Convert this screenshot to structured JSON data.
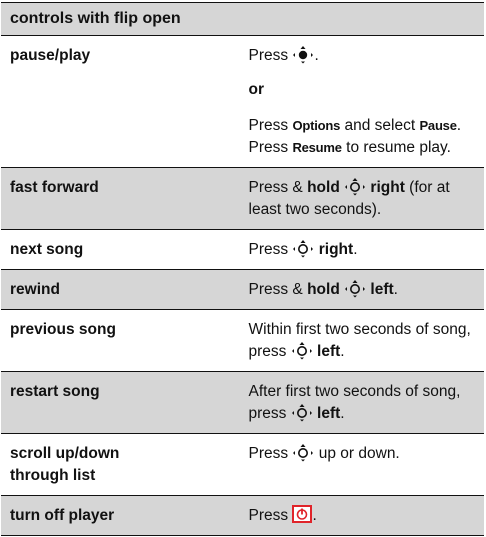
{
  "header": {
    "title": "controls with flip open"
  },
  "rows": [
    {
      "label": "pause/play",
      "lines": [
        {
          "parts": [
            {
              "t": "Press "
            },
            {
              "icon": "nav-center-key"
            },
            {
              "t": "."
            }
          ]
        }
      ],
      "or_label": "or",
      "extra_lines": [
        {
          "parts": [
            {
              "t": "Press "
            },
            {
              "sub": "Options"
            },
            {
              "t": " and select "
            },
            {
              "sub": "Pause"
            },
            {
              "t": "."
            }
          ]
        },
        {
          "parts": [
            {
              "t": "Press "
            },
            {
              "sub": "Resume"
            },
            {
              "t": " to resume play."
            }
          ]
        }
      ]
    },
    {
      "label": "fast forward",
      "lines": [
        {
          "parts": [
            {
              "t": "Press & "
            },
            {
              "b": "hold"
            },
            {
              "t": " "
            },
            {
              "icon": "nav-key"
            },
            {
              "t": " "
            },
            {
              "b": "right"
            },
            {
              "t": " (for at"
            }
          ]
        },
        {
          "parts": [
            {
              "t": "least two seconds)."
            }
          ]
        }
      ]
    },
    {
      "label": "next song",
      "lines": [
        {
          "parts": [
            {
              "t": "Press "
            },
            {
              "icon": "nav-key"
            },
            {
              "t": " "
            },
            {
              "b": "right"
            },
            {
              "t": "."
            }
          ]
        }
      ]
    },
    {
      "label": "rewind",
      "lines": [
        {
          "parts": [
            {
              "t": "Press & "
            },
            {
              "b": "hold"
            },
            {
              "t": " "
            },
            {
              "icon": "nav-key"
            },
            {
              "t": " "
            },
            {
              "b": "left"
            },
            {
              "t": "."
            }
          ]
        }
      ]
    },
    {
      "label": "previous song",
      "lines": [
        {
          "parts": [
            {
              "t": "Within first two seconds of song,"
            }
          ]
        },
        {
          "parts": [
            {
              "t": "press "
            },
            {
              "icon": "nav-key"
            },
            {
              "t": " "
            },
            {
              "b": "left"
            },
            {
              "t": "."
            }
          ]
        }
      ]
    },
    {
      "label": "restart song",
      "lines": [
        {
          "parts": [
            {
              "t": "After first two seconds of song,"
            }
          ]
        },
        {
          "parts": [
            {
              "t": "press "
            },
            {
              "icon": "nav-key"
            },
            {
              "t": " "
            },
            {
              "b": "left"
            },
            {
              "t": "."
            }
          ]
        }
      ]
    },
    {
      "label": "scroll up/down through list",
      "lines": [
        {
          "parts": [
            {
              "t": "Press "
            },
            {
              "icon": "nav-key"
            },
            {
              "t": " up or down."
            }
          ]
        }
      ]
    },
    {
      "label": "turn off player",
      "lines": [
        {
          "parts": [
            {
              "t": "Press "
            },
            {
              "icon": "power-key"
            },
            {
              "t": "."
            }
          ]
        }
      ]
    }
  ],
  "colors": {
    "row_gray": "#d6d6d6",
    "row_white": "#ffffff",
    "power_key": "#e0242a",
    "rule": "#111111"
  }
}
